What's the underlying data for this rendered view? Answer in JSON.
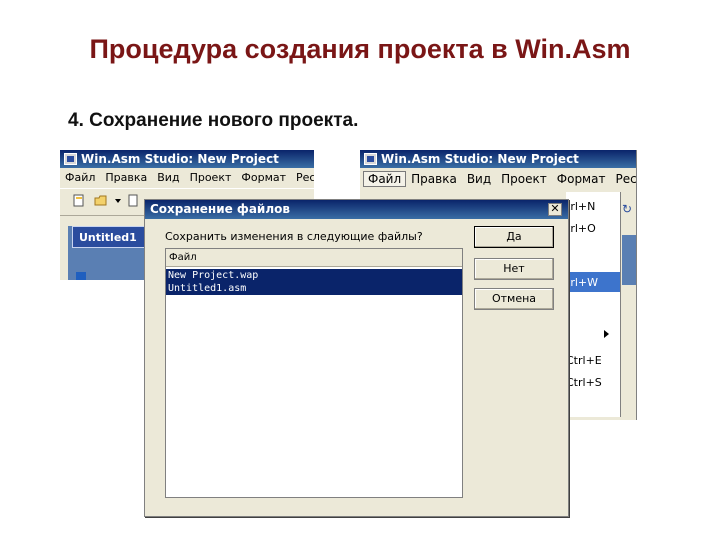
{
  "slide": {
    "title": "Процедура создания проекта в Win.Asm",
    "step": "4. Сохранение нового проекта."
  },
  "app_title": "Win.Asm Studio: New Project",
  "left_window": {
    "menu": [
      "Файл",
      "Правка",
      "Вид",
      "Проект",
      "Формат",
      "Ресурс"
    ],
    "doc_tab": "Untitled1"
  },
  "right_window": {
    "menu": [
      "Файл",
      "Правка",
      "Вид",
      "Проект",
      "Формат",
      "Ресу"
    ],
    "selected_menu": "Файл",
    "shortcuts": [
      "trl+N",
      "trl+O",
      "trl+W",
      "Ctrl+E",
      "Ctrl+S"
    ]
  },
  "dialog": {
    "title": "Сохранение файлов",
    "prompt": "Сохранить изменения в следующие файлы?",
    "column_header": "Файл",
    "files": [
      "New Project.wap",
      "Untitled1.asm"
    ],
    "buttons": {
      "yes": "Да",
      "no": "Нет",
      "cancel": "Отмена"
    }
  },
  "colors": {
    "title_text": "#7a1616",
    "titlebar": "#0a246a",
    "selection": "#0a246a",
    "menu_highlight": "#3d74cc",
    "window_face": "#ece9d8"
  }
}
